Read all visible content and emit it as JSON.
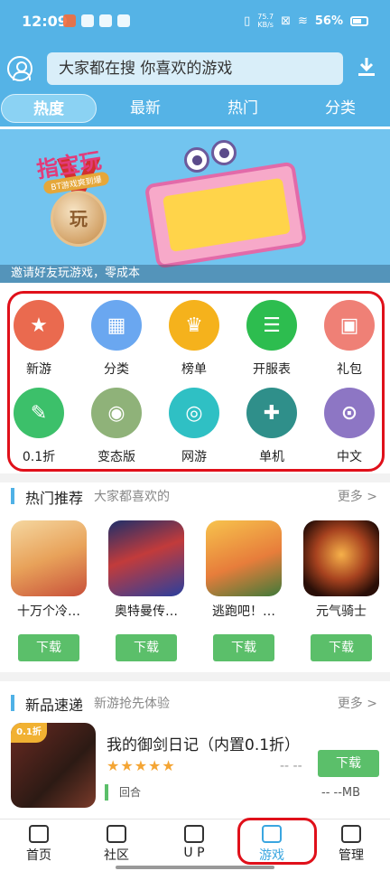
{
  "status": {
    "time": "12:09",
    "speed_top": "75.7",
    "speed_bottom": "KB/s",
    "battery": "56%"
  },
  "search": {
    "placeholder": "大家都在搜  你喜欢的游戏"
  },
  "tabs": [
    {
      "label": "热度",
      "active": true
    },
    {
      "label": "最新"
    },
    {
      "label": "热门"
    },
    {
      "label": "分类"
    }
  ],
  "banner": {
    "caption": "邀请好友玩游戏，零成本",
    "medal_text": "玩",
    "card_title": "指宝玩",
    "card_sub": "BT游戏爽到爆"
  },
  "categories": [
    {
      "label": "新游",
      "color": "#ea6a4f",
      "icon": "new-game-icon"
    },
    {
      "label": "分类",
      "color": "#6aa7f0",
      "icon": "category-icon"
    },
    {
      "label": "榜单",
      "color": "#f5b21c",
      "icon": "crown-icon"
    },
    {
      "label": "开服表",
      "color": "#2dbd4f",
      "icon": "server-list-icon"
    },
    {
      "label": "礼包",
      "color": "#ef8076",
      "icon": "gift-icon"
    },
    {
      "label": "0.1折",
      "color": "#3cc06a",
      "icon": "discount-icon"
    },
    {
      "label": "变态版",
      "color": "#8fb279",
      "icon": "bt-gamepad-icon"
    },
    {
      "label": "网游",
      "color": "#2fc0c4",
      "icon": "online-game-icon"
    },
    {
      "label": "单机",
      "color": "#2f8f8a",
      "icon": "console-icon"
    },
    {
      "label": "中文",
      "color": "#8d76c4",
      "icon": "chinese-game-icon"
    }
  ],
  "hot": {
    "title": "热门推荐",
    "subtitle": "大家都喜欢的",
    "more": "更多 >",
    "games": [
      {
        "name": "十万个冷…",
        "download": "下载"
      },
      {
        "name": "奥特曼传…",
        "download": "下载"
      },
      {
        "name": "逃跑吧！…",
        "download": "下载"
      },
      {
        "name": "元气骑士",
        "download": "下载"
      }
    ]
  },
  "newgames": {
    "title": "新品速递",
    "subtitle": "新游抢先体验",
    "more": "更多 >",
    "item": {
      "badge": "0.1折",
      "title": "我的御剑日记（内置0.1折）",
      "stars": "★★★★★",
      "rating": "-- --",
      "tag": "回合",
      "size": "-- --MB",
      "download": "下载"
    }
  },
  "bottom_nav": [
    {
      "label": "首页"
    },
    {
      "label": "社区"
    },
    {
      "label": "U P"
    },
    {
      "label": "游戏",
      "active": true
    },
    {
      "label": "管理"
    }
  ]
}
